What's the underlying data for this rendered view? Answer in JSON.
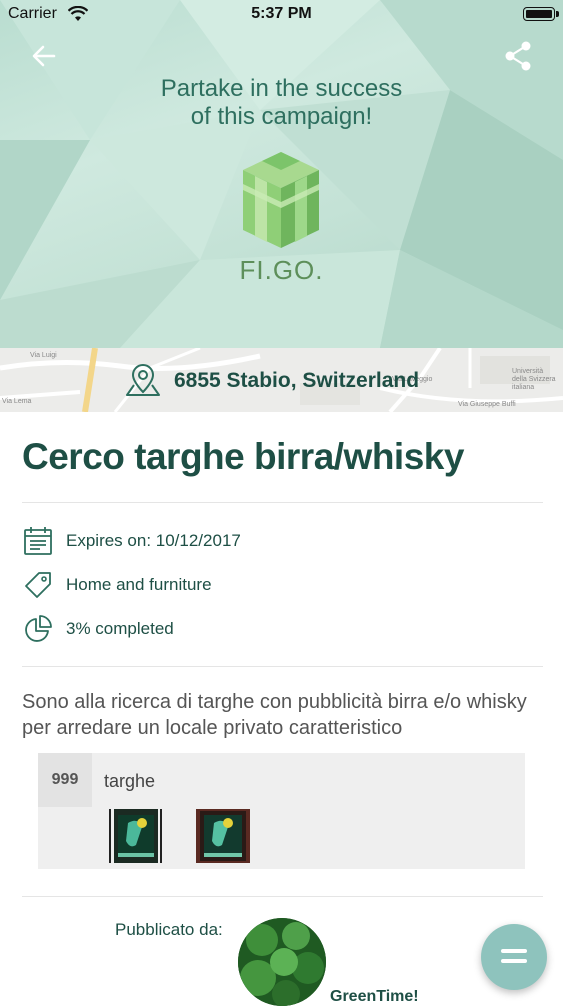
{
  "status_bar": {
    "carrier": "Carrier",
    "time": "5:37 PM"
  },
  "hero": {
    "title_line1": "Partake in the success",
    "title_line2": "of this campaign!",
    "brand": "FI.GO."
  },
  "map": {
    "location": "6855 Stabio, Switzerland",
    "street_labels": [
      "Via Luigi",
      "Via Laveggio",
      "Via Giuseppe Buffi",
      "Università della Svizzera italiana",
      "Via Lema"
    ]
  },
  "campaign": {
    "title": "Cerco targhe birra/whisky",
    "expires": "Expires on: 10/12/2017",
    "category": "Home and furniture",
    "progress": "3% completed",
    "progress_value": 0.03,
    "description": "Sono alla ricerca di targhe con pubblicità birra e/o whisky per arredare un locale privato caratteristico"
  },
  "item": {
    "quantity": "999",
    "name": "targhe"
  },
  "publisher": {
    "label": "Pubblicato da:",
    "name": "GreenTime!"
  },
  "icons": {
    "back": "arrow-left-icon",
    "share": "share-icon",
    "location": "map-pin-icon",
    "calendar": "calendar-icon",
    "tag": "tag-icon",
    "progress": "pie-chart-icon",
    "fab": "menu-icon"
  },
  "colors": {
    "primary_text": "#1e4f45",
    "hero_bg": "#c4e2d6",
    "fab": "#8ec3bd"
  }
}
